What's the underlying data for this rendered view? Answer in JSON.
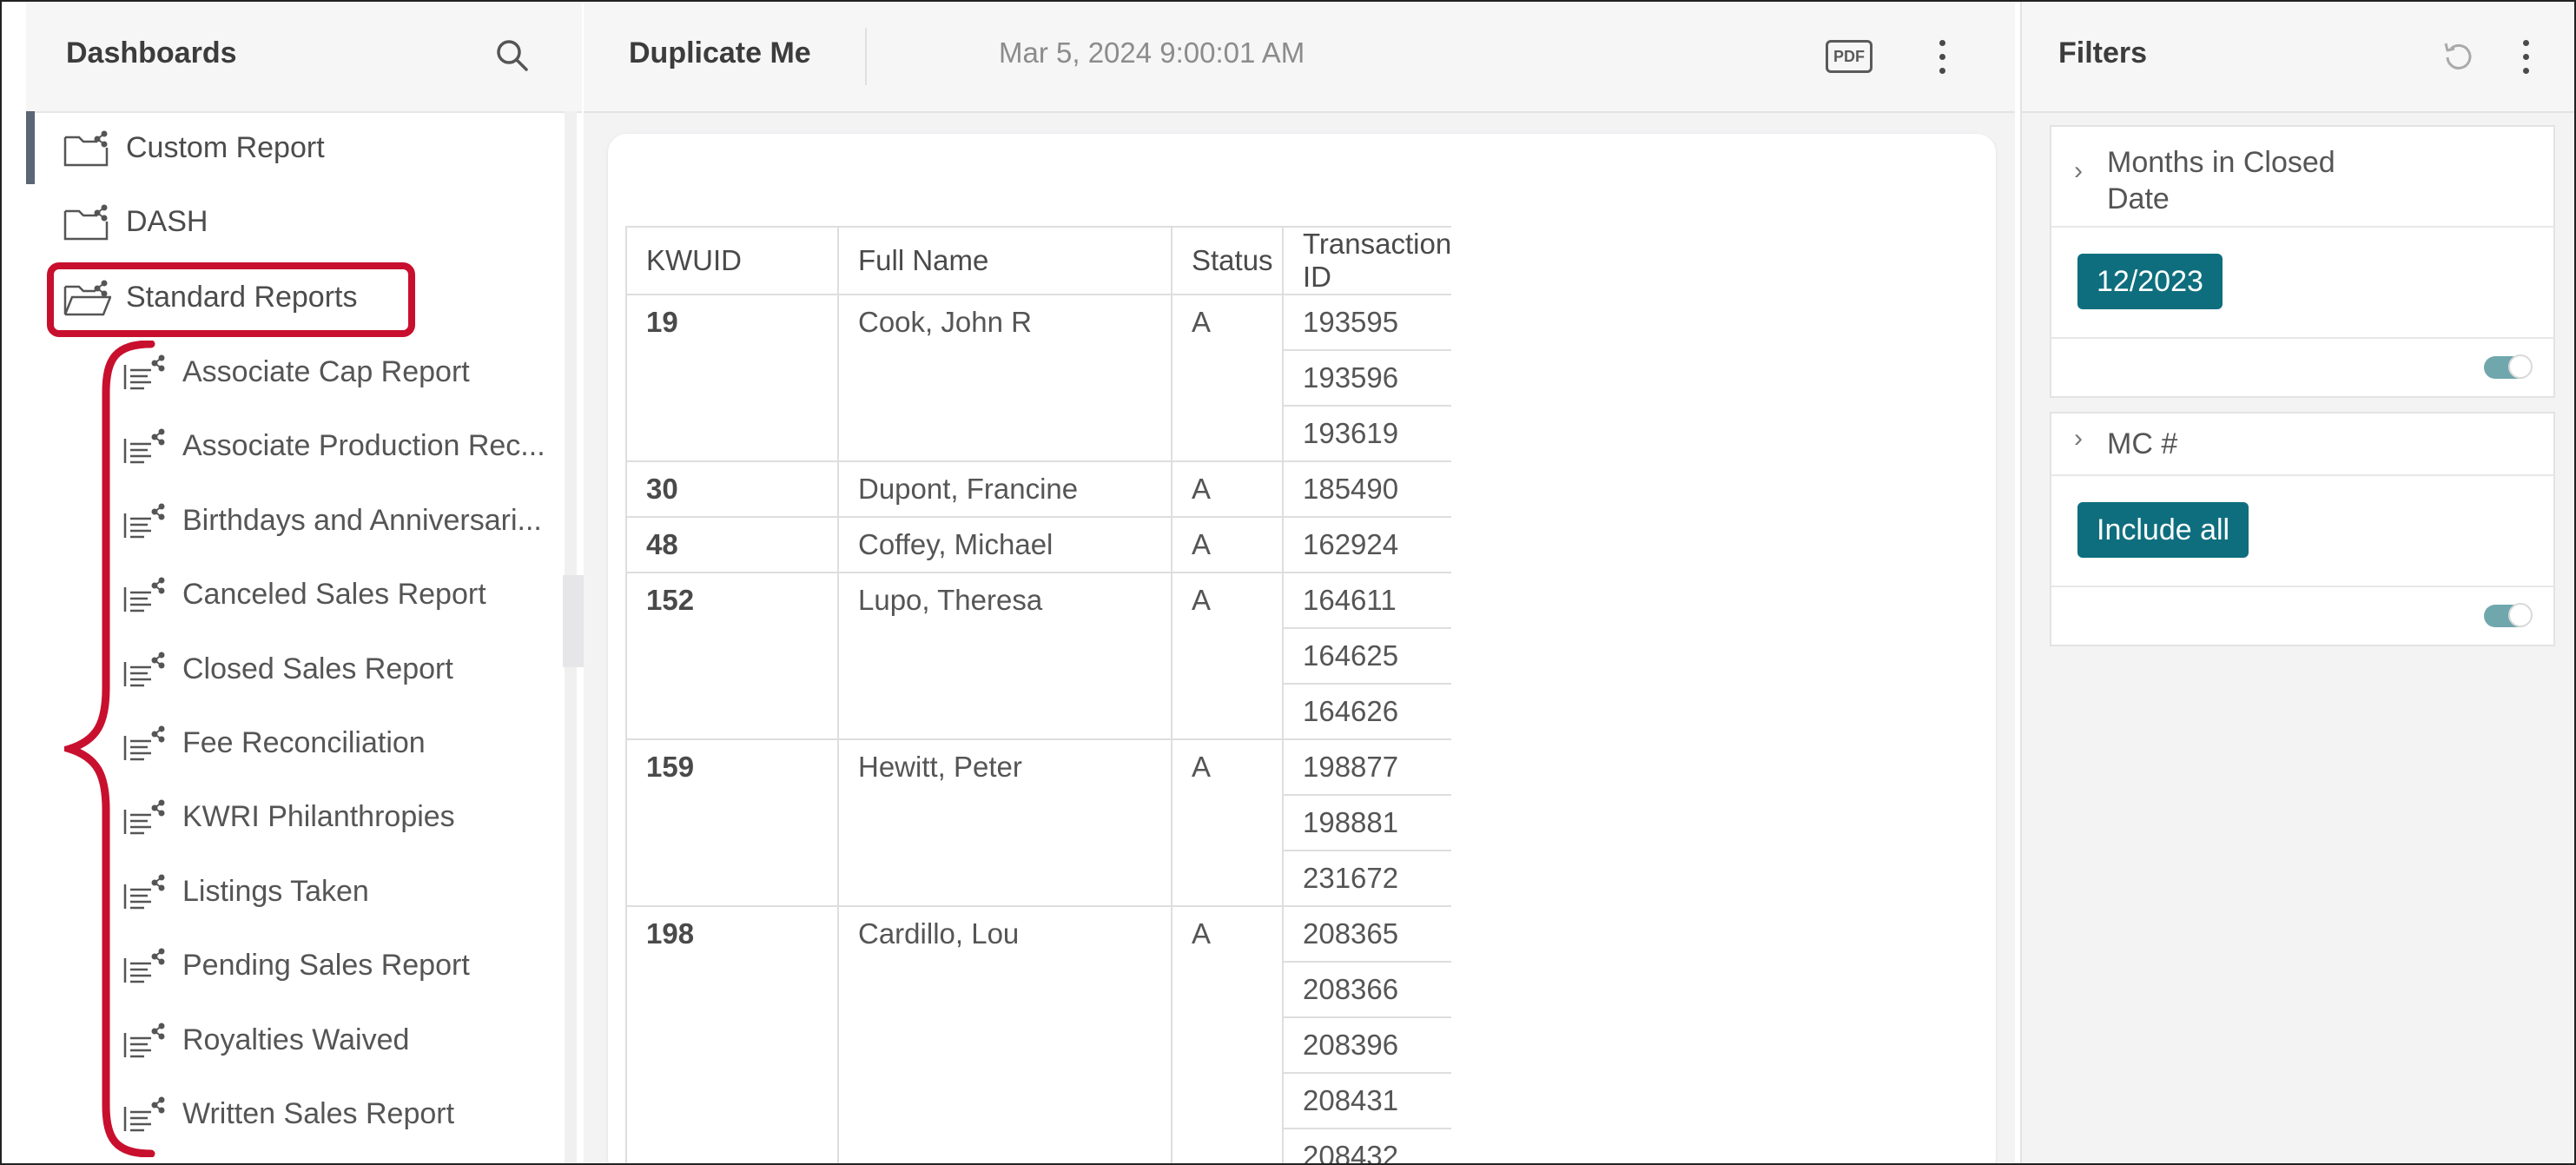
{
  "sidebar": {
    "title": "Dashboards",
    "items": [
      {
        "label": "Custom Report",
        "icon": "folder-share-icon"
      },
      {
        "label": "DASH",
        "icon": "folder-share-icon"
      },
      {
        "label": "Standard Reports",
        "icon": "folder-open-share-icon"
      }
    ],
    "subitems": [
      {
        "label": "Associate Cap Report"
      },
      {
        "label": "Associate Production Rec..."
      },
      {
        "label": "Birthdays and Anniversari..."
      },
      {
        "label": "Canceled Sales Report"
      },
      {
        "label": "Closed Sales Report"
      },
      {
        "label": "Fee Reconciliation"
      },
      {
        "label": "KWRI Philanthropies"
      },
      {
        "label": "Listings Taken"
      },
      {
        "label": "Pending Sales Report"
      },
      {
        "label": "Royalties Waived"
      },
      {
        "label": "Written Sales Report"
      }
    ],
    "highlight_color": "#c8102e"
  },
  "main": {
    "title": "Duplicate Me",
    "date": "Mar 5, 2024 9:00:01 AM",
    "pdf_label": "PDF",
    "table": {
      "headers": [
        "KWUID",
        "Full Name",
        "Status",
        "Transaction ID"
      ],
      "groups": [
        {
          "kwuid": "19",
          "name": "Cook, John R",
          "status": "A",
          "ids": [
            "193595",
            "193596",
            "193619"
          ]
        },
        {
          "kwuid": "30",
          "name": "Dupont, Francine",
          "status": "A",
          "ids": [
            "185490"
          ]
        },
        {
          "kwuid": "48",
          "name": "Coffey, Michael",
          "status": "A",
          "ids": [
            "162924"
          ]
        },
        {
          "kwuid": "152",
          "name": "Lupo, Theresa",
          "status": "A",
          "ids": [
            "164611",
            "164625",
            "164626"
          ]
        },
        {
          "kwuid": "159",
          "name": "Hewitt, Peter",
          "status": "A",
          "ids": [
            "198877",
            "198881",
            "231672"
          ]
        },
        {
          "kwuid": "198",
          "name": "Cardillo, Lou",
          "status": "A",
          "ids": [
            "208365",
            "208366",
            "208396",
            "208431",
            "208432"
          ]
        }
      ]
    }
  },
  "filters": {
    "title": "Filters",
    "cards": [
      {
        "name": "Months in Closed Date",
        "chip": "12/2023"
      },
      {
        "name": "MC #",
        "chip": "Include all"
      }
    ],
    "accent_color": "#0e6e7e"
  }
}
